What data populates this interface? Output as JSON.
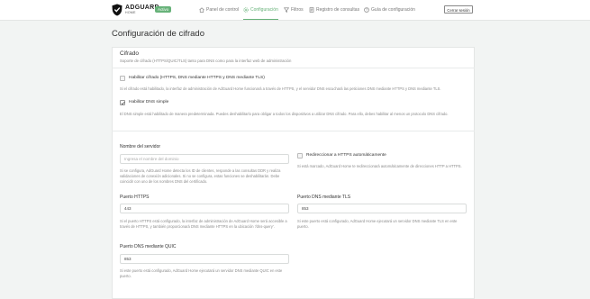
{
  "header": {
    "brand": "ADGUARD",
    "brand_sub": "HOME",
    "status_badge": "Activo",
    "nav": [
      {
        "label": "Panel de control",
        "icon": "dashboard-icon"
      },
      {
        "label": "Configuración",
        "icon": "gear-icon",
        "active": true
      },
      {
        "label": "Filtros",
        "icon": "filter-icon"
      },
      {
        "label": "Registro de consultas",
        "icon": "log-icon"
      },
      {
        "label": "Guía de configuración",
        "icon": "help-icon"
      }
    ],
    "logout": "Cerrar sesión"
  },
  "page": {
    "title": "Configuración de cifrado"
  },
  "card": {
    "title": "Cifrado",
    "subtitle": "Soporte de cifrado (HTTPS/QUIC/TLS) tanto para DNS como para la interfaz web de administración"
  },
  "encryption": {
    "enable_label": "Habilitar cifrado (HTTPS, DNS mediante HTTPS y DNS mediante TLS)",
    "enable_checked": false,
    "enable_desc": "Si el cifrado está habilitado, la interfaz de administración de AdGuard Home funcionará a través de HTTPS, y el servidor DNS escuchará las peticiones DNS mediante HTTPS y DNS mediante TLS.",
    "plain_label": "Habilitar DNS simple",
    "plain_checked": true,
    "plain_desc": "El DNS simple está habilitado de manera predeterminada. Puedes deshabilitarlo para obligar a todos los dispositivos a utilizar DNS cifrado. Para ello, debes habilitar al menos un protocolo DNS cifrado."
  },
  "fields": {
    "server_name_label": "Nombre del servidor",
    "server_name_placeholder": "Ingresa el nombre del dominio",
    "server_name_desc": "Si se configura, AdGuard Home detecta los ID de clientes, responde a las consultas DDR y realiza validaciones de conexión adicionales. Si no se configura, estas funciones se deshabilitarán. Debe coincidir con uno de los nombres DNS del certificado.",
    "redirect_label": "Redireccionar a HTTPS automáticamente",
    "redirect_desc": "Si está marcado, AdGuard Home te redireccionará automáticamente de direcciones HTTP a HTTPS.",
    "https_port_label": "Puerto HTTPS",
    "https_port_value": "443",
    "https_port_desc": "Si el puerto HTTPS está configurado, la interfaz de administración de AdGuard Home será accesible a través de HTTPS, y también proporcionará DNS mediante HTTPS en la ubicación '/dns-query'.",
    "tls_port_label": "Puerto DNS mediante TLS",
    "tls_port_value": "853",
    "tls_port_desc": "Si este puerto está configurado, AdGuard Home ejecutará un servidor DNS mediante TLS en este puerto.",
    "quic_port_label": "Puerto DNS mediante QUIC",
    "quic_port_value": "853",
    "quic_port_desc": "Si este puerto está configurado, AdGuard Home ejecutará un servidor DNS mediante QUIC en este puerto."
  }
}
